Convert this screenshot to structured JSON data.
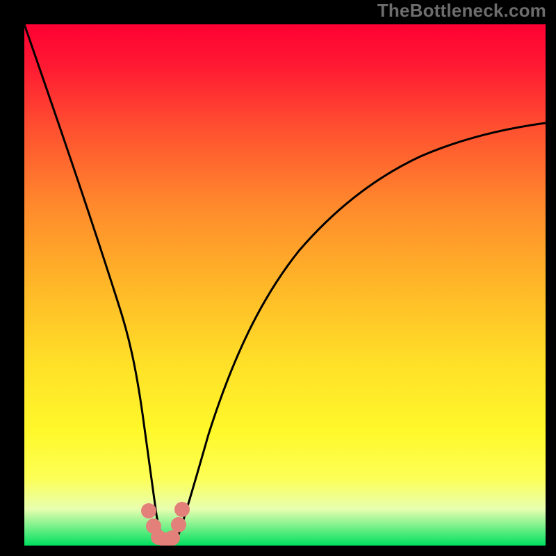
{
  "watermark": "TheBottleneck.com",
  "chart_data": {
    "type": "line",
    "title": "",
    "xlabel": "",
    "ylabel": "",
    "xlim": [
      0,
      100
    ],
    "ylim": [
      0,
      100
    ],
    "series": [
      {
        "name": "bottleneck-curve",
        "x": [
          0,
          5,
          10,
          15,
          18,
          20,
          22,
          24,
          25,
          26,
          27,
          28,
          29,
          30,
          32,
          35,
          40,
          45,
          50,
          55,
          60,
          65,
          70,
          75,
          80,
          85,
          90,
          95,
          100
        ],
        "values": [
          100,
          83,
          65,
          46,
          34,
          25,
          16,
          7,
          3,
          1,
          0,
          0,
          1,
          3,
          10,
          22,
          37,
          47,
          54,
          60,
          64,
          67,
          70,
          72,
          73,
          74,
          75,
          76,
          77
        ]
      }
    ],
    "markers": {
      "name": "highlight-dots",
      "color": "#e57373",
      "points": [
        {
          "x": 23.5,
          "y": 5.5
        },
        {
          "x": 24.5,
          "y": 2.5
        },
        {
          "x": 25.5,
          "y": 0.8
        },
        {
          "x": 27.0,
          "y": 0.8
        },
        {
          "x": 28.5,
          "y": 1.0
        },
        {
          "x": 29.5,
          "y": 3.5
        },
        {
          "x": 30.0,
          "y": 6.0
        }
      ]
    },
    "gradient_stops": [
      {
        "pos": 0,
        "color": "#ff0033"
      },
      {
        "pos": 35,
        "color": "#ff8a2c"
      },
      {
        "pos": 78,
        "color": "#fff82a"
      },
      {
        "pos": 100,
        "color": "#00e060"
      }
    ]
  }
}
